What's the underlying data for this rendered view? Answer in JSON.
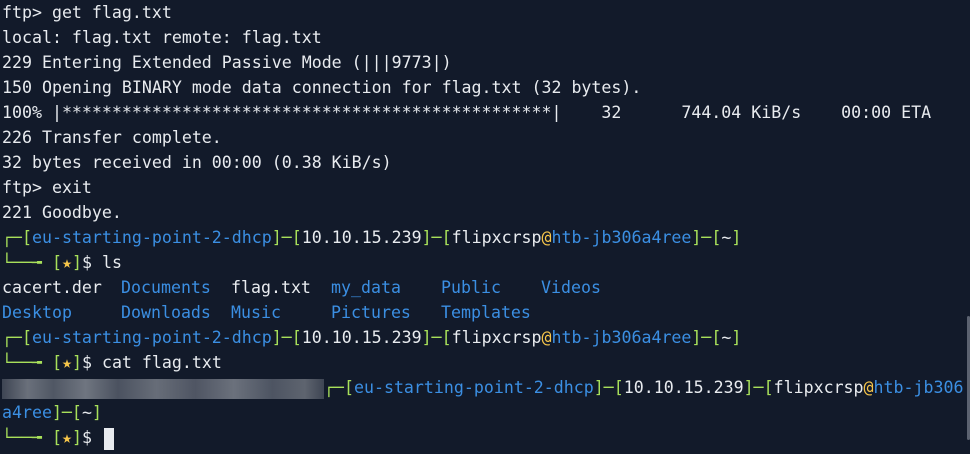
{
  "ftp_session": {
    "l1": "ftp> get flag.txt",
    "l2": "local: flag.txt remote: flag.txt",
    "l3": "229 Entering Extended Passive Mode (|||9773|)",
    "l4": "150 Opening BINARY mode data connection for flag.txt (32 bytes).",
    "l5": "100% |*************************************************|    32      744.04 KiB/s    00:00 ETA",
    "l6": "226 Transfer complete.",
    "l7": "32 bytes received in 00:00 (0.38 KiB/s)",
    "l8": "ftp> exit",
    "l9": "221 Goodbye."
  },
  "prompt": {
    "host": "eu-starting-point-2-dhcp",
    "ip": "10.10.15.239",
    "user": "flipxcrsp",
    "at": "@",
    "machine": "htb-jb306a4ree",
    "machine_part1": "htb-jb306",
    "machine_part2": "a4ree",
    "cwd": "~",
    "star": "★",
    "dollar": "$"
  },
  "commands": {
    "ls": "ls",
    "cat": "cat flag.txt",
    "empty": ""
  },
  "ls_output": [
    {
      "name": "cacert.der",
      "type": "file"
    },
    {
      "name": "Documents",
      "type": "dir"
    },
    {
      "name": "flag.txt",
      "type": "file"
    },
    {
      "name": "my_data",
      "type": "dir"
    },
    {
      "name": "Public",
      "type": "dir"
    },
    {
      "name": "Videos",
      "type": "dir"
    },
    {
      "name": "Desktop",
      "type": "dir"
    },
    {
      "name": "Downloads",
      "type": "dir"
    },
    {
      "name": "Music",
      "type": "dir"
    },
    {
      "name": "Pictures",
      "type": "dir"
    },
    {
      "name": "Templates",
      "type": "dir"
    }
  ],
  "colors": {
    "background": "#121a2a",
    "text": "#e8ebef",
    "prompt_green": "#a8e05a",
    "directory_blue": "#3b8fe3",
    "star_yellow": "#f7c64a"
  }
}
